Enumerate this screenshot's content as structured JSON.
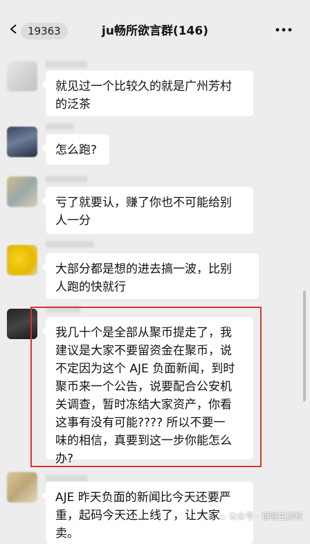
{
  "header": {
    "unread_count": "19363",
    "title": "ju畅所欲言群(146)"
  },
  "messages": [
    {
      "text": "就见过一个比较久的就是广州芳村\n的泛茶"
    },
    {
      "text": "怎么跑?"
    },
    {
      "text": "亏了就要认，赚了你也不可能给别\n人一分"
    },
    {
      "text": "大部分都是想的进去搞一波，比别\n人跑的快就行"
    },
    {
      "text": "我几十个是全部从聚币提走了，我\n建议是大家不要留资金在聚币，说\n不定因为这个 AJE 负面新闻，到时\n聚币来一个公告，说要配合公安机\n关调查，暂时冻结大家资产，你看\n这事有没有可能???? 所以不要一\n味的相信，真要到这一步你能怎么\n办?"
    },
    {
      "text": "AJE 昨天负面的新闻比今天还要严\n重，起码今天还上线了，让大家\n卖。"
    }
  ],
  "watermark": {
    "text": "公众号 · 百晓生解析",
    "icon": "wechat-icon"
  },
  "colors": {
    "background": "#ededed",
    "bubble": "#ffffff",
    "highlight": "#d9342b"
  }
}
